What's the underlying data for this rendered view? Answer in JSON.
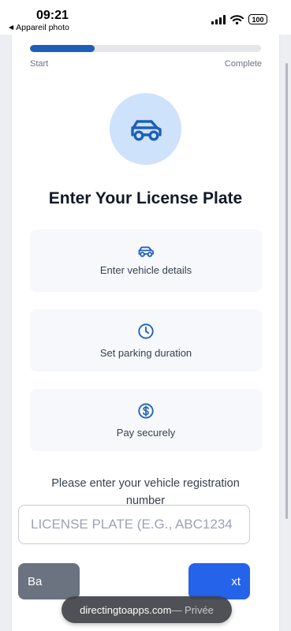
{
  "status_bar": {
    "time": "09:21",
    "back_app": "Appareil photo",
    "battery": "100"
  },
  "progress": {
    "start_label": "Start",
    "end_label": "Complete",
    "fraction": 0.28
  },
  "colors": {
    "accent": "#1d5fb8",
    "primary_button": "#2563eb",
    "secondary_button": "#6b7280",
    "hero_bg": "#cfe2fb"
  },
  "hero": {
    "icon": "car-icon"
  },
  "title": "Enter Your License Plate",
  "features": [
    {
      "icon": "car-icon",
      "label": "Enter vehicle details"
    },
    {
      "icon": "clock-icon",
      "label": "Set parking duration"
    },
    {
      "icon": "dollar-icon",
      "label": "Pay securely"
    }
  ],
  "instruction": "Please enter your vehicle registration number",
  "plate_input": {
    "placeholder": "LICENSE PLATE (E.G., ABC1234",
    "value": ""
  },
  "buttons": {
    "back_label": "Ba",
    "next_label": "xt"
  },
  "browser": {
    "domain": "directingtoapps.com",
    "privacy": " — Privée"
  }
}
